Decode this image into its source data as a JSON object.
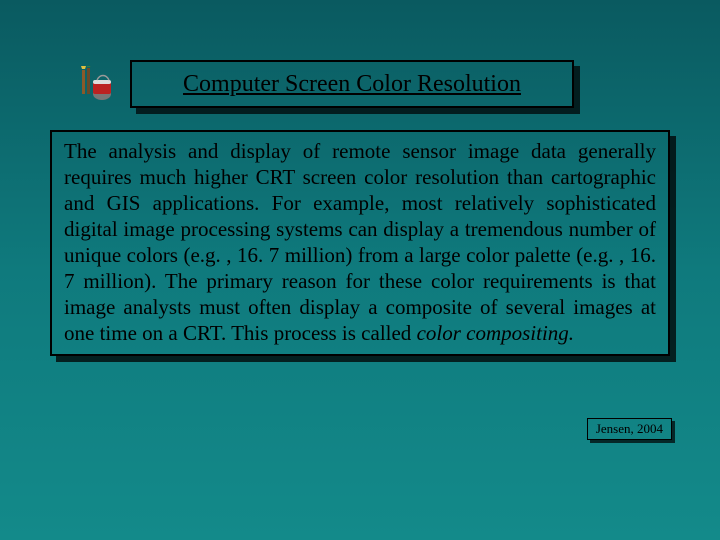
{
  "title": "Computer Screen Color Resolution",
  "body_start": "The analysis and display of remote sensor image data generally requires much higher CRT screen color resolution than cartographic and GIS applications. For example, most relatively sophisticated digital image processing systems can display a tremendous number of unique colors (e.g. , 16. 7 million) from a large color palette (e.g. , 16. 7 million). The primary reason for these color requirements is that image analysts must often display a composite of several images at one time on a CRT. This process is called ",
  "body_emph": "color compositing.",
  "citation": "Jensen, 2004",
  "icon_name": "paint-supplies-icon"
}
